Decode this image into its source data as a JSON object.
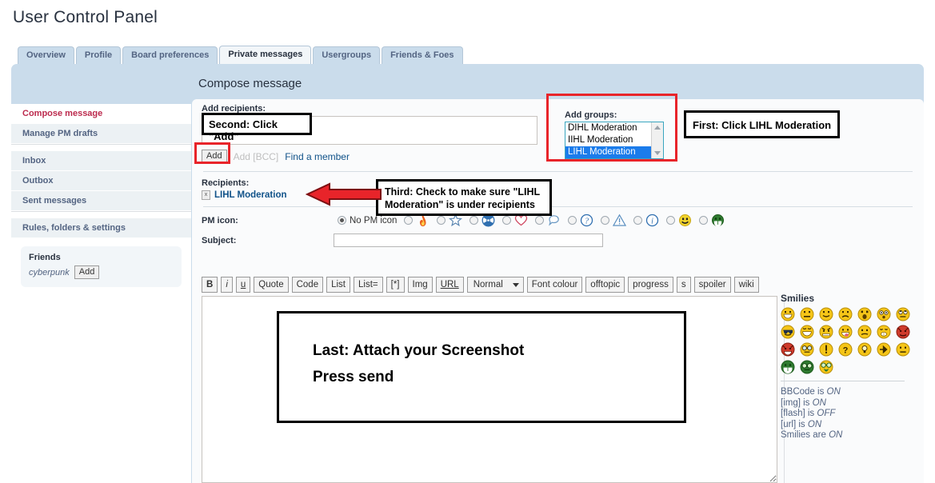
{
  "page_title": "User Control Panel",
  "tabs": [
    {
      "label": "Overview",
      "active": false
    },
    {
      "label": "Profile",
      "active": false
    },
    {
      "label": "Board preferences",
      "active": false
    },
    {
      "label": "Private messages",
      "active": true
    },
    {
      "label": "Usergroups",
      "active": false
    },
    {
      "label": "Friends & Foes",
      "active": false
    }
  ],
  "content_header": "Compose message",
  "sidebar": {
    "items": [
      {
        "label": "Compose message",
        "active": true
      },
      {
        "label": "Manage PM drafts",
        "active": false
      },
      {
        "label": "Inbox",
        "active": false
      },
      {
        "label": "Outbox",
        "active": false
      },
      {
        "label": "Sent messages",
        "active": false
      },
      {
        "label": "Rules, folders & settings",
        "active": false
      }
    ],
    "friends": {
      "title": "Friends",
      "name": "cyberpunk",
      "add_label": "Add"
    }
  },
  "form": {
    "add_recipients_label": "Add recipients:",
    "recipients_value": "",
    "add_button": "Add",
    "add_bcc_button": "Add [BCC]",
    "find_member_link": "Find a member",
    "add_groups_label": "Add groups:",
    "groups": [
      {
        "label": "DIHL Moderation",
        "selected": false
      },
      {
        "label": "IIHL Moderation",
        "selected": false
      },
      {
        "label": "LIHL Moderation",
        "selected": true
      }
    ],
    "recipients_label": "Recipients:",
    "recipient_chip": "LIHL Moderation",
    "pm_icon_label": "PM icon:",
    "no_pm_icon_label": "No PM icon",
    "pm_icons": [
      "fire-icon",
      "star-icon",
      "radiation-icon",
      "heart-icon",
      "thought-bubble-icon",
      "question-icon",
      "warning-icon",
      "info-icon",
      "smiley-icon",
      "green-grin-icon"
    ],
    "subject_label": "Subject:",
    "subject_value": "",
    "subject_placeholder": ""
  },
  "bbcode_buttons": [
    {
      "label": "B",
      "style": "b"
    },
    {
      "label": "i",
      "style": "i"
    },
    {
      "label": "u",
      "style": "u"
    },
    {
      "label": "Quote",
      "style": ""
    },
    {
      "label": "Code",
      "style": ""
    },
    {
      "label": "List",
      "style": ""
    },
    {
      "label": "List=",
      "style": ""
    },
    {
      "label": "[*]",
      "style": ""
    },
    {
      "label": "Img",
      "style": ""
    },
    {
      "label": "URL",
      "style": "url"
    }
  ],
  "font_size_select": "Normal",
  "bbcode_buttons_2": [
    {
      "label": "Font colour"
    },
    {
      "label": "offtopic"
    },
    {
      "label": "progress"
    },
    {
      "label": "s"
    },
    {
      "label": "spoiler"
    },
    {
      "label": "wiki"
    }
  ],
  "message_body": "",
  "smilies": {
    "title": "Smilies",
    "icons": [
      "grin-icon",
      "neutral-icon",
      "smile-icon",
      "sad-icon",
      "shocked-icon",
      "surprised-icon",
      "rolleyes-icon",
      "cool-icon",
      "laugh-icon",
      "mad-icon",
      "razz-icon",
      "confused-icon",
      "cry-icon",
      "evil-icon",
      "twisted-icon",
      "geek-icon",
      "exclaim-icon",
      "question-icon",
      "idea-icon",
      "arrow-icon",
      "neutral2-icon",
      "mrgreen-icon",
      "nerd-icon",
      "ugeek-icon"
    ],
    "status": [
      {
        "name": "BBCode is",
        "value": "ON"
      },
      {
        "name": "[img] is",
        "value": "ON"
      },
      {
        "name": "[flash] is",
        "value": "OFF"
      },
      {
        "name": "[url] is",
        "value": "ON"
      },
      {
        "name": "Smilies are",
        "value": "ON"
      }
    ]
  },
  "annotations": {
    "first": "First: Click LIHL Moderation",
    "second": "Second: Click \"Add\"",
    "third": "Third: Check to make sure \"LIHL Moderation\" is under recipients",
    "last_line1": "Last: Attach your Screenshot",
    "last_line2": "Press send"
  },
  "colors": {
    "panel_blue": "#cadceb",
    "tab_active_bg": "#f2f6f9",
    "link_blue": "#105289",
    "active_nav_red": "#bc2a4d",
    "annotation_red": "#e8242a",
    "select_highlight": "#1b7ceb",
    "select_border": "#3aa6c0"
  }
}
